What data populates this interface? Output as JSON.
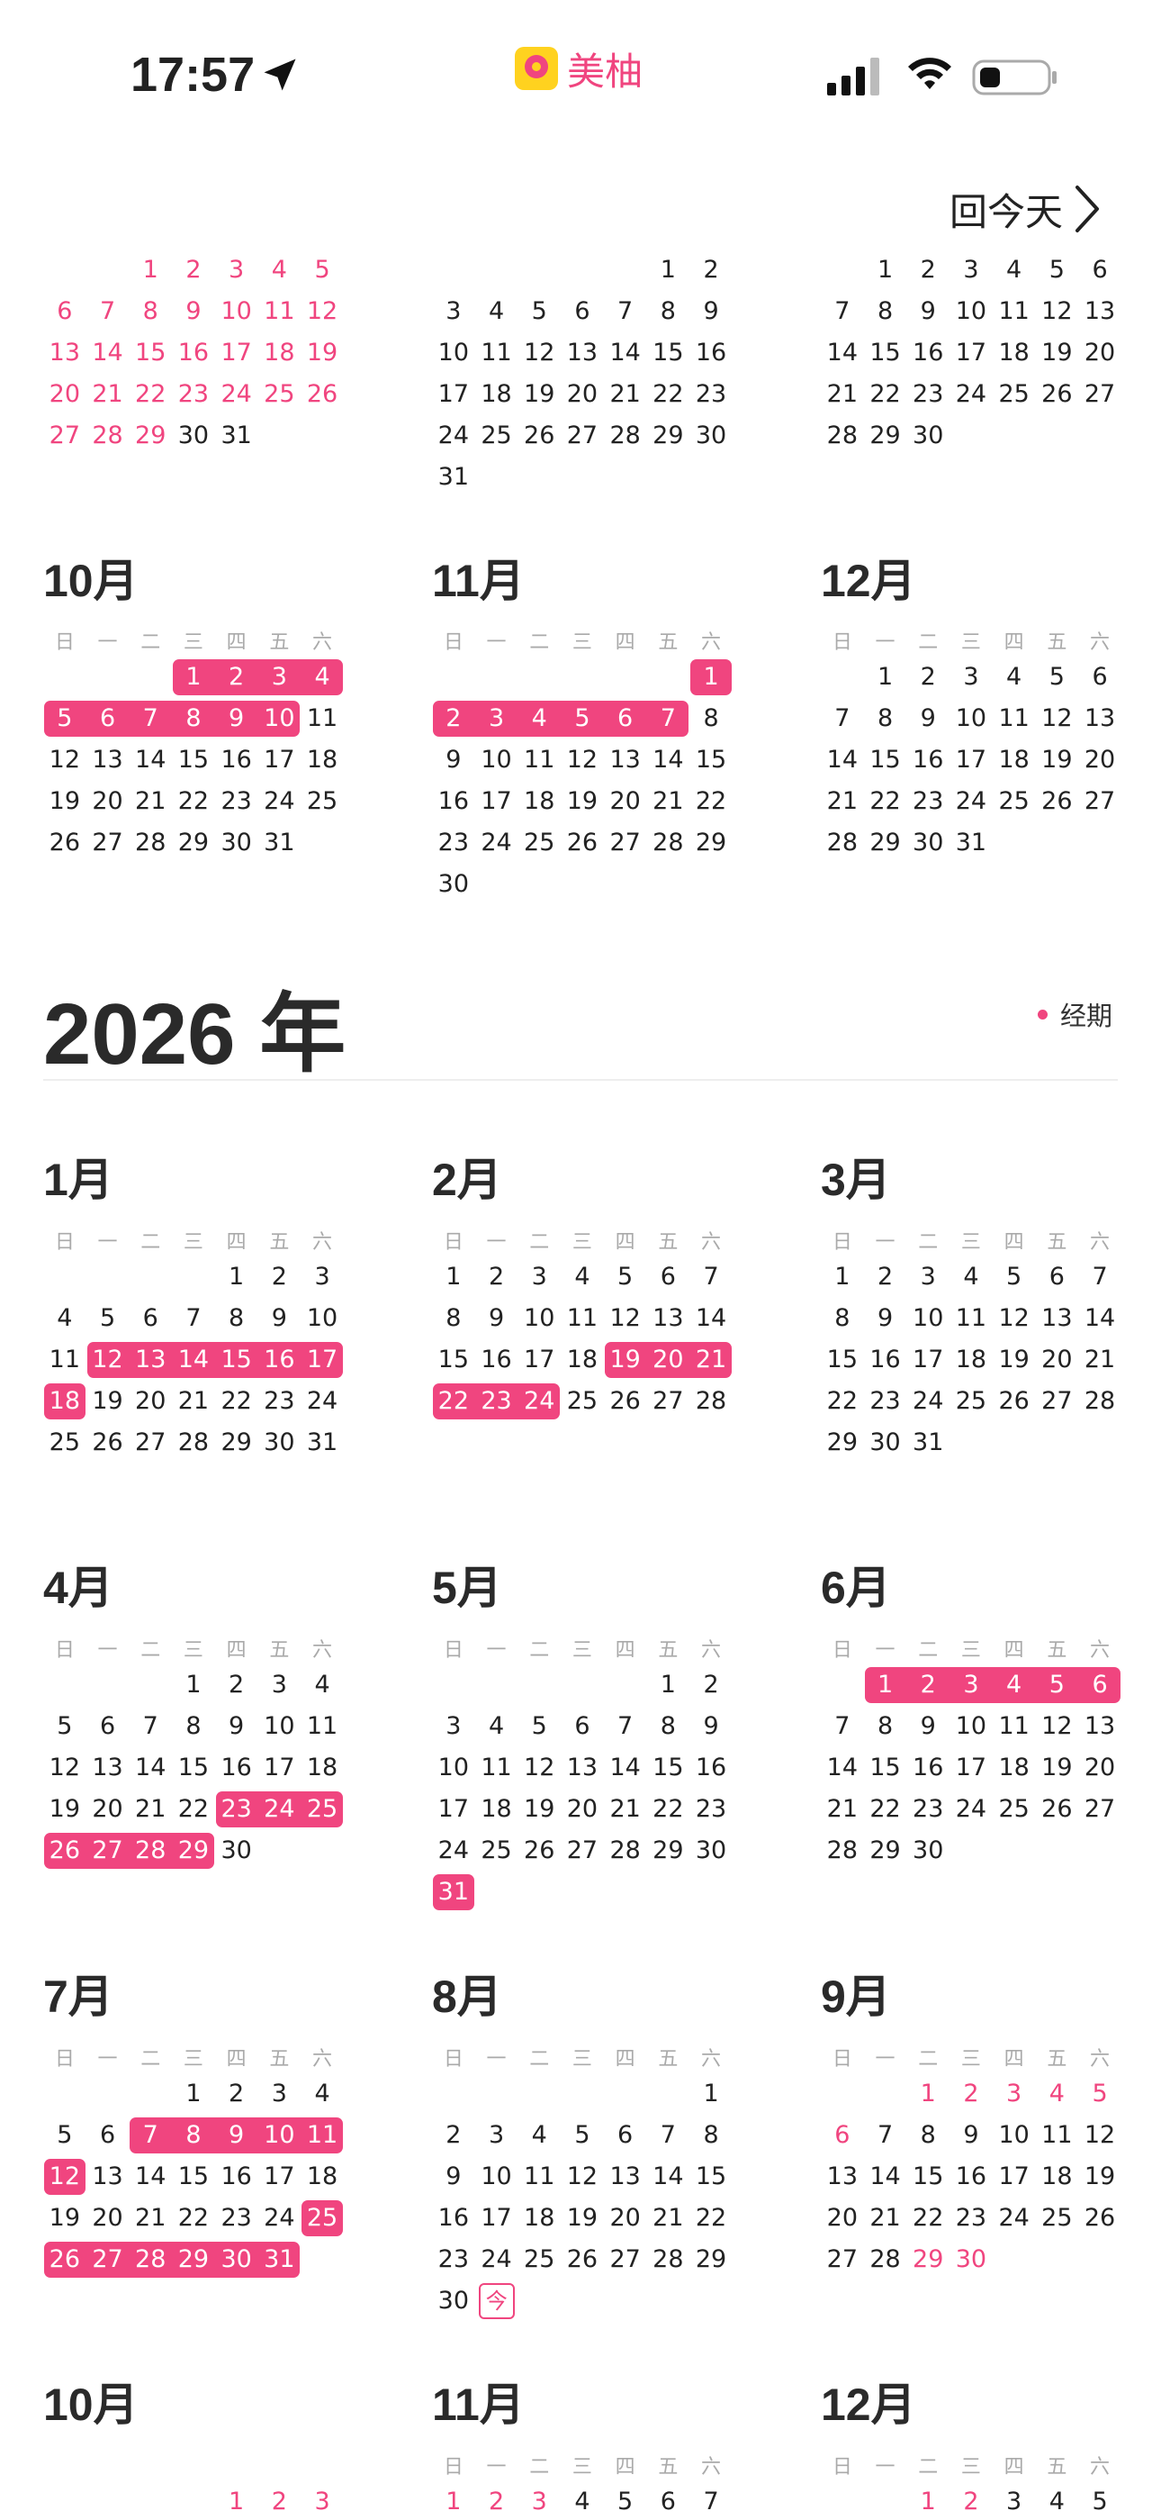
{
  "status_bar": {
    "time": "17:57",
    "app_name": "美柚"
  },
  "nav": {
    "today_label": "回今天"
  },
  "weekday_labels": [
    "日",
    "一",
    "二",
    "三",
    "四",
    "五",
    "六"
  ],
  "year_header": {
    "year_label": "2026 年",
    "legend_label": "经期"
  },
  "colors": {
    "accent": "#f0457f",
    "text": "#222222",
    "weekday": "#aaaaaa"
  },
  "months": [
    {
      "id": "2025-07",
      "title": "",
      "first": 2,
      "days": 31,
      "period": [],
      "pink": [
        1,
        2,
        3,
        4,
        5,
        6,
        7,
        8,
        9,
        10,
        11,
        12,
        13,
        14,
        15,
        16,
        17,
        18,
        19,
        20,
        21,
        22,
        23,
        24,
        25,
        26,
        27,
        28,
        29
      ],
      "show_weekdays": false
    },
    {
      "id": "2025-08",
      "title": "",
      "first": 5,
      "days": 31,
      "period": [],
      "pink": [],
      "show_weekdays": false
    },
    {
      "id": "2025-09",
      "title": "",
      "first": 1,
      "days": 30,
      "period": [],
      "pink": [],
      "show_weekdays": false
    },
    {
      "id": "2025-10",
      "title": "10月",
      "first": 3,
      "days": 31,
      "period": [
        1,
        2,
        3,
        4,
        5,
        6,
        7,
        8,
        9,
        10
      ],
      "pink": [],
      "show_weekdays": true
    },
    {
      "id": "2025-11",
      "title": "11月",
      "first": 6,
      "days": 30,
      "period": [
        1,
        2,
        3,
        4,
        5,
        6,
        7
      ],
      "pink": [],
      "show_weekdays": true
    },
    {
      "id": "2025-12",
      "title": "12月",
      "first": 1,
      "days": 31,
      "period": [],
      "pink": [],
      "show_weekdays": true
    },
    {
      "id": "2026-01",
      "title": "1月",
      "first": 4,
      "days": 31,
      "period": [
        12,
        13,
        14,
        15,
        16,
        17,
        18
      ],
      "pink": [],
      "show_weekdays": true
    },
    {
      "id": "2026-02",
      "title": "2月",
      "first": 0,
      "days": 28,
      "period": [
        19,
        20,
        21,
        22,
        23,
        24
      ],
      "pink": [],
      "show_weekdays": true
    },
    {
      "id": "2026-03",
      "title": "3月",
      "first": 0,
      "days": 31,
      "period": [],
      "pink": [],
      "show_weekdays": true
    },
    {
      "id": "2026-04",
      "title": "4月",
      "first": 3,
      "days": 30,
      "period": [
        23,
        24,
        25,
        26,
        27,
        28,
        29
      ],
      "pink": [],
      "show_weekdays": true
    },
    {
      "id": "2026-05",
      "title": "5月",
      "first": 5,
      "days": 31,
      "period": [
        31
      ],
      "pink": [],
      "show_weekdays": true
    },
    {
      "id": "2026-06",
      "title": "6月",
      "first": 1,
      "days": 30,
      "period": [
        1,
        2,
        3,
        4,
        5,
        6
      ],
      "pink": [],
      "show_weekdays": true
    },
    {
      "id": "2026-07",
      "title": "7月",
      "first": 3,
      "days": 31,
      "period": [
        7,
        8,
        9,
        10,
        11,
        12,
        25,
        26,
        27,
        28,
        29,
        30,
        31
      ],
      "pink": [],
      "show_weekdays": true
    },
    {
      "id": "2026-08",
      "title": "8月",
      "first": 6,
      "days": 31,
      "period": [],
      "pink": [],
      "today": 31,
      "today_label": "今",
      "show_weekdays": true
    },
    {
      "id": "2026-09",
      "title": "9月",
      "first": 2,
      "days": 30,
      "period": [],
      "pink": [
        1,
        2,
        3,
        4,
        5,
        6,
        29,
        30
      ],
      "show_weekdays": true
    },
    {
      "id": "2026-10",
      "title": "10月",
      "first": 4,
      "days": 3,
      "period": [],
      "pink": [
        1,
        2,
        3
      ],
      "show_weekdays": false
    },
    {
      "id": "2026-11",
      "title": "11月",
      "first": 0,
      "days": 7,
      "period": [],
      "pink": [
        1,
        2,
        3
      ],
      "show_weekdays": true
    },
    {
      "id": "2026-12",
      "title": "12月",
      "first": 2,
      "days": 5,
      "period": [],
      "pink": [
        1,
        2
      ],
      "show_weekdays": true
    }
  ]
}
